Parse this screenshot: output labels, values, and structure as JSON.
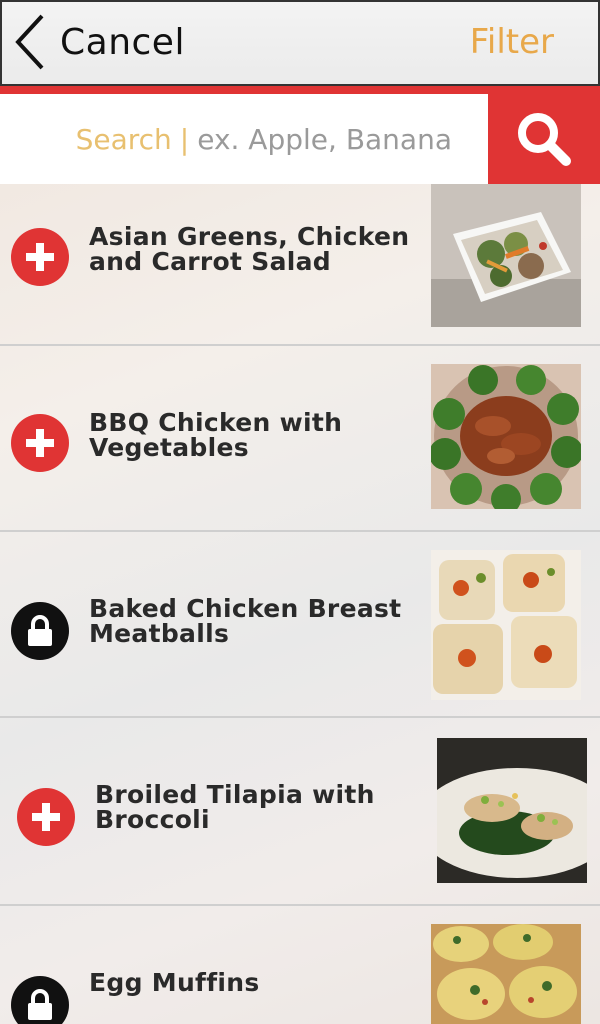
{
  "header": {
    "back_label": "Cancel",
    "filter_label": "Filter"
  },
  "search": {
    "label": "Search",
    "separator": "|",
    "hint": "ex. Apple, Banana"
  },
  "colors": {
    "accent_red": "#e03434",
    "filter_orange": "#e8a84a"
  },
  "recipes": [
    {
      "title_line1": "Asian Greens, Chicken",
      "title_line2": "and Carrot Salad",
      "status": "add",
      "icon": "plus-icon",
      "thumb": "salad-thumbnail"
    },
    {
      "title_line1": "BBQ Chicken with",
      "title_line2": "Vegetables",
      "status": "add",
      "icon": "plus-icon",
      "thumb": "bbq-chicken-thumbnail"
    },
    {
      "title_line1": "Baked Chicken Breast",
      "title_line2": "Meatballs",
      "status": "locked",
      "icon": "lock-icon",
      "thumb": "meatballs-thumbnail"
    },
    {
      "title_line1": "Broiled Tilapia with",
      "title_line2": "Broccoli",
      "status": "add",
      "icon": "plus-icon",
      "thumb": "tilapia-thumbnail"
    },
    {
      "title_line1": "Egg Muffins",
      "title_line2": "",
      "status": "locked",
      "icon": "lock-icon",
      "thumb": "egg-muffins-thumbnail"
    }
  ]
}
